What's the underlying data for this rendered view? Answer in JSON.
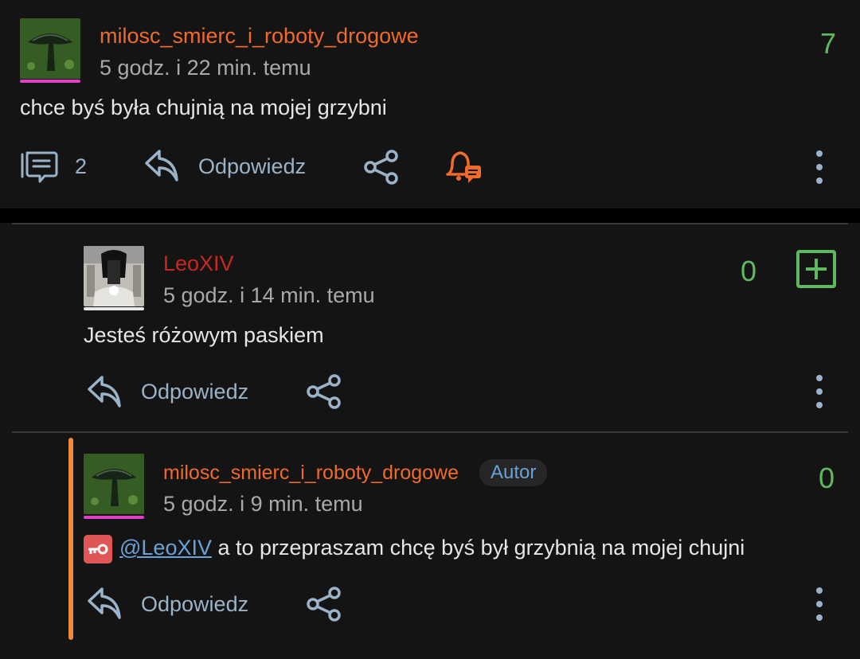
{
  "colors": {
    "accent_orange": "#f06a2a",
    "user_red": "#c8281e",
    "score_green": "#5fb85f",
    "link_blue": "#6aa2d6",
    "action_blue": "#9bb3c8",
    "thread_line": "#f08a3a",
    "avatar_bar_pink": "#e13fc8"
  },
  "comment1": {
    "username": "milosc_smierc_i_roboty_drogowe",
    "timestamp": "5 godz. i 22 min. temu",
    "score": "7",
    "text": "chce byś była chujnią na mojej grzybni",
    "replies_count": "2",
    "reply_label": "Odpowiedz",
    "avatar_icon": "mushroom-avatar",
    "icons": [
      "comments-icon",
      "reply-icon",
      "share-icon",
      "bell-notification-icon",
      "more-vertical-icon"
    ]
  },
  "comment2": {
    "username": "LeoXIV",
    "timestamp": "5 godz. i 14 min. temu",
    "score": "0",
    "text": "Jesteś różowym paskiem",
    "reply_label": "Odpowiedz",
    "avatar_icon": "statue-avatar",
    "icons": [
      "plus-square-icon",
      "reply-icon",
      "share-icon",
      "more-vertical-icon"
    ]
  },
  "comment3": {
    "username": "milosc_smierc_i_roboty_drogowe",
    "author_badge": "Autor",
    "timestamp": "5 godz. i 9 min. temu",
    "score": "0",
    "mention": "@LeoXIV",
    "text": " a to przepraszam chcę byś był grzybnią na mojej chujni",
    "reply_label": "Odpowiedz",
    "avatar_icon": "mushroom-avatar",
    "icons": [
      "key-badge-icon",
      "reply-icon",
      "share-icon",
      "more-vertical-icon"
    ]
  }
}
